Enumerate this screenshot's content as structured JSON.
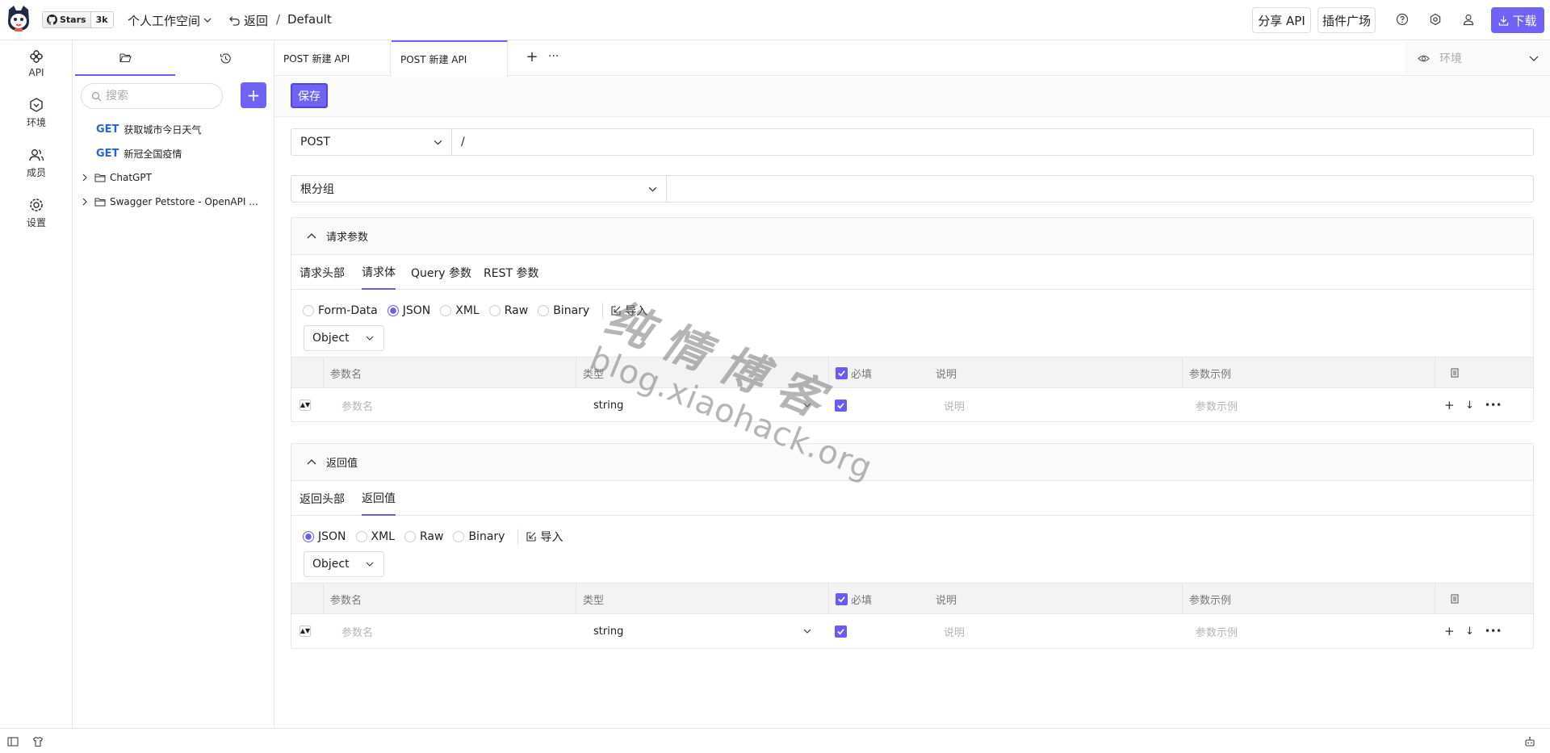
{
  "header": {
    "github": {
      "stars_label": "Stars",
      "count": "3k"
    },
    "workspace": "个人工作空间",
    "back_label": "返回",
    "breadcrumb_sep": "/",
    "breadcrumb": "Default",
    "share_label": "分享 API",
    "plugin_label": "插件广场",
    "download_label": "下载"
  },
  "nav": {
    "items": [
      {
        "label": "API",
        "icon": "api-icon"
      },
      {
        "label": "环境",
        "icon": "environment-icon"
      },
      {
        "label": "成员",
        "icon": "members-icon"
      },
      {
        "label": "设置",
        "icon": "settings-icon"
      }
    ]
  },
  "sidebar": {
    "search_placeholder": "搜索",
    "add_label": "+",
    "items": [
      {
        "method": "GET",
        "name": "获取城市今日天气"
      },
      {
        "method": "GET",
        "name": "新冠全国疫情"
      },
      {
        "name": "ChatGPT"
      },
      {
        "name": "Swagger Petstore - OpenAPI ..."
      }
    ]
  },
  "tabs": {
    "items": [
      {
        "label": "POST 新建 API"
      },
      {
        "label": "POST 新建 API"
      }
    ],
    "add": "+",
    "more": "···",
    "env_placeholder": "环境"
  },
  "editor": {
    "save_label": "保存",
    "method": "POST",
    "url": "/",
    "group": "根分组",
    "request": {
      "title": "请求参数",
      "tabs": [
        "请求头部",
        "请求体",
        "Query 参数",
        "REST 参数"
      ],
      "active_tab": "请求体",
      "body_types": [
        "Form-Data",
        "JSON",
        "XML",
        "Raw",
        "Binary"
      ],
      "selected_body_type": "JSON",
      "import_label": "导入",
      "root_type": "Object"
    },
    "response": {
      "title": "返回值",
      "tabs": [
        "返回头部",
        "返回值"
      ],
      "active_tab": "返回值",
      "body_types": [
        "JSON",
        "XML",
        "Raw",
        "Binary"
      ],
      "selected_body_type": "JSON",
      "import_label": "导入",
      "root_type": "Object"
    },
    "columns": {
      "name": "参数名",
      "type": "类型",
      "required": "必填",
      "desc": "说明",
      "example": "参数示例"
    },
    "row": {
      "name_placeholder": "参数名",
      "type": "string",
      "desc_placeholder": "说明",
      "example_placeholder": "参数示例"
    }
  },
  "watermark": {
    "line1": "纯情博客",
    "line2": "blog.xiaohack.org"
  },
  "colors": {
    "accent": "#7162f6",
    "method_get": "#2863d6"
  }
}
